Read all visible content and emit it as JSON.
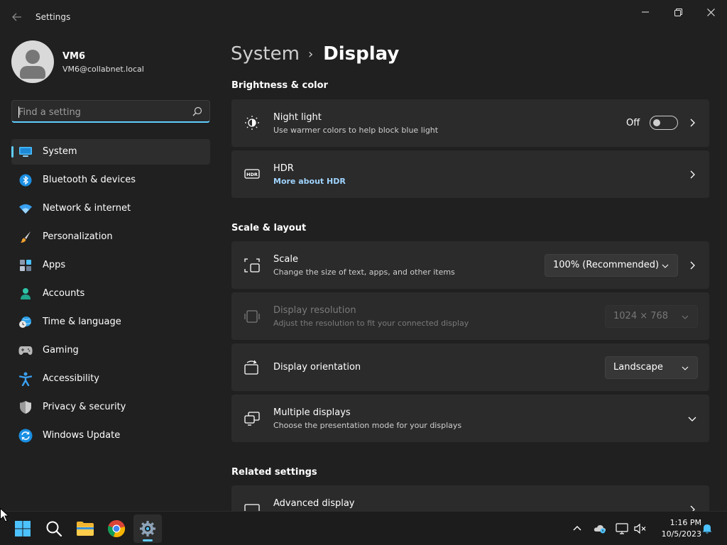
{
  "window": {
    "title": "Settings"
  },
  "profile": {
    "name": "VM6",
    "email": "VM6@collabnet.local"
  },
  "search": {
    "placeholder": "Find a setting"
  },
  "nav": {
    "items": [
      {
        "label": "System",
        "icon": "system-icon"
      },
      {
        "label": "Bluetooth & devices",
        "icon": "bluetooth-icon"
      },
      {
        "label": "Network & internet",
        "icon": "wifi-icon"
      },
      {
        "label": "Personalization",
        "icon": "brush-icon"
      },
      {
        "label": "Apps",
        "icon": "apps-icon"
      },
      {
        "label": "Accounts",
        "icon": "accounts-icon"
      },
      {
        "label": "Time & language",
        "icon": "globe-clock-icon"
      },
      {
        "label": "Gaming",
        "icon": "gamepad-icon"
      },
      {
        "label": "Accessibility",
        "icon": "accessibility-icon"
      },
      {
        "label": "Privacy & security",
        "icon": "shield-icon"
      },
      {
        "label": "Windows Update",
        "icon": "update-icon"
      }
    ]
  },
  "breadcrumb": {
    "parent": "System",
    "separator": "›",
    "current": "Display"
  },
  "sections": {
    "brightness": "Brightness & color",
    "scale_layout": "Scale & layout",
    "related": "Related settings"
  },
  "cards": {
    "night_light": {
      "title": "Night light",
      "subtitle": "Use warmer colors to help block blue light",
      "state": "Off"
    },
    "hdr": {
      "title": "HDR",
      "link": "More about HDR"
    },
    "scale": {
      "title": "Scale",
      "subtitle": "Change the size of text, apps, and other items",
      "value": "100% (Recommended)"
    },
    "resolution": {
      "title": "Display resolution",
      "subtitle": "Adjust the resolution to fit your connected display",
      "value": "1024 × 768"
    },
    "orientation": {
      "title": "Display orientation",
      "value": "Landscape"
    },
    "multiple": {
      "title": "Multiple displays",
      "subtitle": "Choose the presentation mode for your displays"
    },
    "advanced": {
      "title": "Advanced display"
    }
  },
  "taskbar": {
    "time": "1:16 PM",
    "date": "10/5/2023"
  },
  "colors": {
    "accent": "#60cdff",
    "background": "#202020",
    "card": "#2b2b2b"
  }
}
